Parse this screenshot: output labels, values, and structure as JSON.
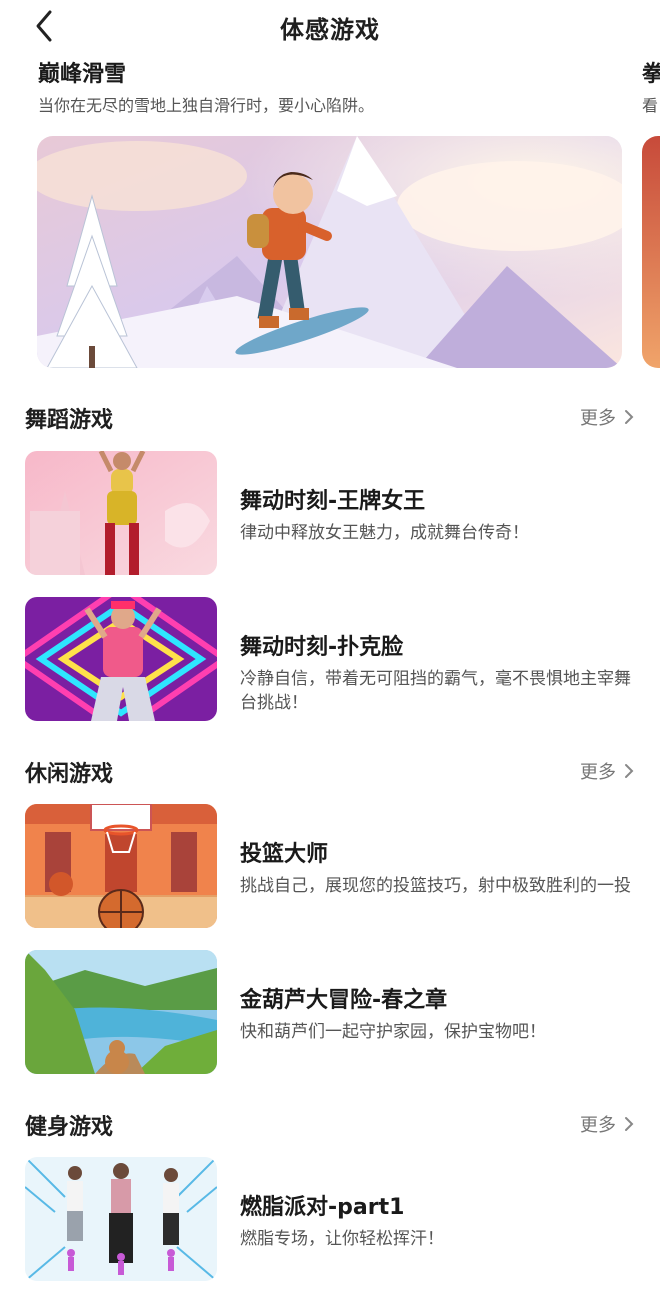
{
  "header": {
    "title": "体感游戏"
  },
  "banners": [
    {
      "title": "巅峰滑雪",
      "description": "当你在无尽的雪地上独自滑行时，要小心陷阱。"
    },
    {
      "title": "拳",
      "description": "看"
    }
  ],
  "sections": [
    {
      "title": "舞蹈游戏",
      "more_label": "更多",
      "games": [
        {
          "name": "舞动时刻-王牌女王",
          "description": "律动中释放女王魅力，成就舞台传奇！"
        },
        {
          "name": "舞动时刻-扑克脸",
          "description": "冷静自信，带着无可阻挡的霸气，毫不畏惧地主宰舞台挑战！"
        }
      ]
    },
    {
      "title": "休闲游戏",
      "more_label": "更多",
      "games": [
        {
          "name": "投篮大师",
          "description": "挑战自己，展现您的投篮技巧，射中极致胜利的一投"
        },
        {
          "name": "金葫芦大冒险-春之章",
          "description": "快和葫芦们一起守护家园，保护宝物吧！"
        }
      ]
    },
    {
      "title": "健身游戏",
      "more_label": "更多",
      "games": [
        {
          "name": "燃脂派对-part1",
          "description": "燃脂专场，让你轻松挥汗！"
        }
      ]
    }
  ],
  "icons": {
    "back": "chevron-left-icon",
    "more": "chevron-right-icon"
  },
  "colors": {
    "text_primary": "#1a1a1a",
    "text_secondary": "#555555",
    "more_text": "#777777"
  }
}
